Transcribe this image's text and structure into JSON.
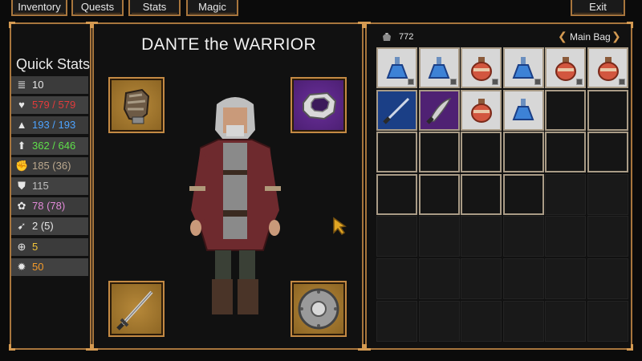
{
  "menu": {
    "inventory": "Inventory",
    "quests": "Quests",
    "stats": "Stats",
    "magic": "Magic",
    "exit": "Exit"
  },
  "quick_stats": {
    "title": "Quick Stats",
    "rows": [
      {
        "icon": "scroll-icon",
        "value": "10",
        "color": "#e8e8e8"
      },
      {
        "icon": "heart-icon",
        "value": "579 / 579",
        "color": "#e23b3b"
      },
      {
        "icon": "wizard-hat-icon",
        "value": "193 / 193",
        "color": "#4da3ff"
      },
      {
        "icon": "arrow-up-icon",
        "value": "362 / 646",
        "color": "#5fe04a"
      },
      {
        "icon": "flexed-arm-icon",
        "value": "185 (36)",
        "color": "#bba88e"
      },
      {
        "icon": "shield-icon",
        "value": "115",
        "color": "#bfbfbf"
      },
      {
        "icon": "brain-icon",
        "value": "78 (78)",
        "color": "#e28ad8"
      },
      {
        "icon": "running-man-icon",
        "value": "2 (5)",
        "color": "#e8e8e8"
      },
      {
        "icon": "crosshair-icon",
        "value": "5",
        "color": "#f2c53a"
      },
      {
        "icon": "burst-icon",
        "value": "50",
        "color": "#f39a2a"
      }
    ]
  },
  "character": {
    "title": "DANTE the WARRIOR"
  },
  "bag": {
    "gold": "772",
    "name": "Main Bag"
  },
  "inventory_items": [
    {
      "icon": "blue-potion-icon",
      "qty_badge": true
    },
    {
      "icon": "blue-potion-icon",
      "qty_badge": true
    },
    {
      "icon": "red-potion-icon",
      "qty_badge": true
    },
    {
      "icon": "blue-potion-icon",
      "qty_badge": true
    },
    {
      "icon": "red-potion-icon",
      "qty_badge": true
    },
    {
      "icon": "red-potion-icon",
      "qty_badge": true
    },
    {
      "icon": "sword-icon",
      "qty_badge": false
    },
    {
      "icon": "scimitar-icon",
      "qty_badge": false
    },
    {
      "icon": "red-potion-icon",
      "qty_badge": false
    },
    {
      "icon": "blue-potion-icon",
      "qty_badge": false
    }
  ],
  "colors": {
    "frame": "#a8763d",
    "slot_gold": "#a87a32",
    "slot_purple": "#5b2886",
    "item_blue": "#1b3f86"
  }
}
